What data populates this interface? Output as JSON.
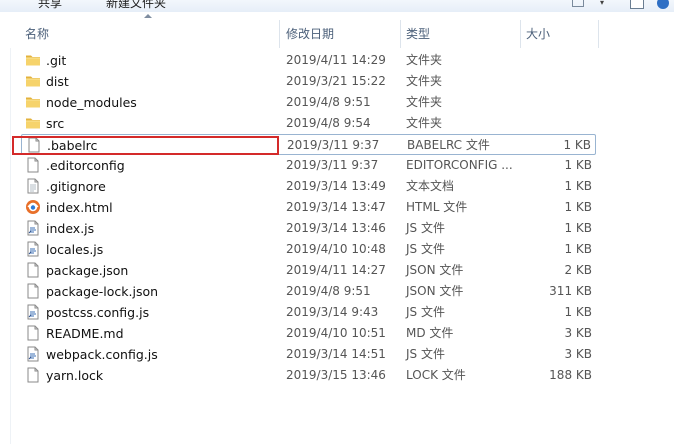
{
  "toolbar": {
    "share_label": "共享",
    "new_folder_label": "新建文件夹"
  },
  "columns": {
    "name": "名称",
    "date": "修改日期",
    "type": "类型",
    "size": "大小"
  },
  "files": [
    {
      "name": ".git",
      "date": "2019/4/11 14:29",
      "type": "文件夹",
      "size": "",
      "icon": "folder-icon"
    },
    {
      "name": "dist",
      "date": "2019/3/21 15:22",
      "type": "文件夹",
      "size": "",
      "icon": "folder-icon"
    },
    {
      "name": "node_modules",
      "date": "2019/4/8 9:51",
      "type": "文件夹",
      "size": "",
      "icon": "folder-icon"
    },
    {
      "name": "src",
      "date": "2019/4/8 9:54",
      "type": "文件夹",
      "size": "",
      "icon": "folder-icon"
    },
    {
      "name": ".babelrc",
      "date": "2019/3/11 9:37",
      "type": "BABELRC 文件",
      "size": "1 KB",
      "icon": "blank-file-icon"
    },
    {
      "name": ".editorconfig",
      "date": "2019/3/11 9:37",
      "type": "EDITORCONFIG ...",
      "size": "1 KB",
      "icon": "blank-file-icon"
    },
    {
      "name": ".gitignore",
      "date": "2019/3/14 13:49",
      "type": "文本文档",
      "size": "1 KB",
      "icon": "text-file-icon"
    },
    {
      "name": "index.html",
      "date": "2019/3/14 13:47",
      "type": "HTML 文件",
      "size": "1 KB",
      "icon": "browser-file-icon"
    },
    {
      "name": "index.js",
      "date": "2019/3/14 13:46",
      "type": "JS 文件",
      "size": "1 KB",
      "icon": "script-file-icon"
    },
    {
      "name": "locales.js",
      "date": "2019/4/10 10:48",
      "type": "JS 文件",
      "size": "1 KB",
      "icon": "script-file-icon"
    },
    {
      "name": "package.json",
      "date": "2019/4/11 14:27",
      "type": "JSON 文件",
      "size": "2 KB",
      "icon": "blank-file-icon"
    },
    {
      "name": "package-lock.json",
      "date": "2019/4/8 9:51",
      "type": "JSON 文件",
      "size": "311 KB",
      "icon": "blank-file-icon"
    },
    {
      "name": "postcss.config.js",
      "date": "2019/3/14 9:43",
      "type": "JS 文件",
      "size": "1 KB",
      "icon": "script-file-icon"
    },
    {
      "name": "README.md",
      "date": "2019/4/10 10:51",
      "type": "MD 文件",
      "size": "3 KB",
      "icon": "blank-file-icon"
    },
    {
      "name": "webpack.config.js",
      "date": "2019/3/14 14:51",
      "type": "JS 文件",
      "size": "3 KB",
      "icon": "script-file-icon"
    },
    {
      "name": "yarn.lock",
      "date": "2019/3/15 13:46",
      "type": "LOCK 文件",
      "size": "188 KB",
      "icon": "blank-file-icon"
    }
  ],
  "selected_file": ".babelrc",
  "colors": {
    "folder": "#f2c95a",
    "selection_border": "#99b4d1",
    "highlight_box": "#d42a2a",
    "header_text": "#4c607a"
  }
}
